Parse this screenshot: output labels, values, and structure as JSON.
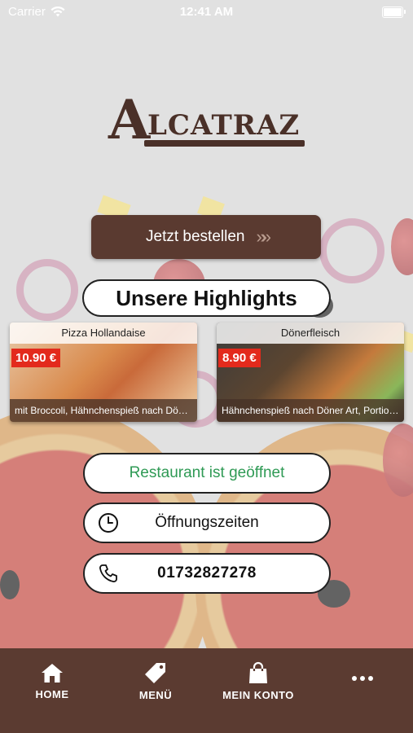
{
  "status_bar": {
    "carrier": "Carrier",
    "time": "12:41 AM"
  },
  "logo": {
    "first_letter": "A",
    "rest": "LCATRAZ"
  },
  "order_button": {
    "label": "Jetzt bestellen",
    "chevrons": "»»"
  },
  "highlights": {
    "title": "Unsere Highlights",
    "items": [
      {
        "name": "Pizza Hollandaise",
        "price": "10.90 €",
        "description": "mit Broccoli, Hähnchenspieß nach Döner..."
      },
      {
        "name": "Dönerfleisch",
        "price": "8.90 €",
        "description": "Hähnchenspieß nach Döner Art, Portion ..."
      }
    ]
  },
  "buttons": {
    "status": "Restaurant ist geöffnet",
    "hours": "Öffnungszeiten",
    "phone": "01732827278"
  },
  "colors": {
    "brand": "#5b3b31",
    "open_green": "#2f9a55",
    "price_red": "#e32a1c"
  },
  "tabbar": {
    "items": [
      {
        "label": "HOME",
        "icon": "home-icon"
      },
      {
        "label": "MENÜ",
        "icon": "tag-icon"
      },
      {
        "label": "MEIN KONTO",
        "icon": "bag-icon"
      },
      {
        "label": "",
        "icon": "more-icon"
      }
    ]
  }
}
